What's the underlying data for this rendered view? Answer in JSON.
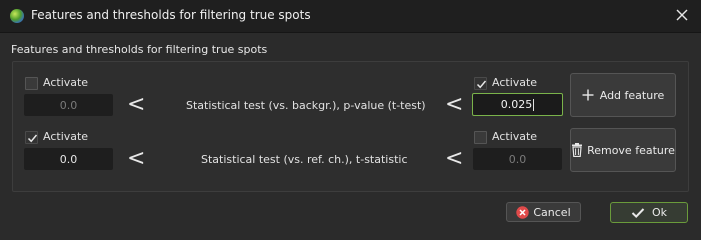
{
  "window": {
    "title": "Features and thresholds for filtering true spots"
  },
  "group": {
    "label": "Features and thresholds for filtering true spots"
  },
  "rows": [
    {
      "left_activate": {
        "label": "Activate",
        "checked": false
      },
      "left_value": "0.0",
      "left_op": "<",
      "feature": "Statistical test (vs. backgr.), p-value (t-test)",
      "right_op": "<",
      "right_activate": {
        "label": "Activate",
        "checked": true
      },
      "right_value": "0.025"
    },
    {
      "left_activate": {
        "label": "Activate",
        "checked": true
      },
      "left_value": "0.0",
      "left_op": "<",
      "feature": "Statistical test (vs. ref. ch.), t-statistic",
      "right_op": "<",
      "right_activate": {
        "label": "Activate",
        "checked": false
      },
      "right_value": "0.0"
    }
  ],
  "side_buttons": {
    "add_feature": {
      "label": "Add feature",
      "icon": "plus-icon"
    },
    "remove_feature": {
      "label": "Remove feature",
      "icon": "trash-icon"
    }
  },
  "footer": {
    "cancel": {
      "label": "Cancel",
      "icon": "cancel-icon",
      "icon_color": "#e04a4a"
    },
    "ok": {
      "label": "Ok",
      "icon": "check-icon",
      "accent": "#6a9b3b"
    }
  }
}
